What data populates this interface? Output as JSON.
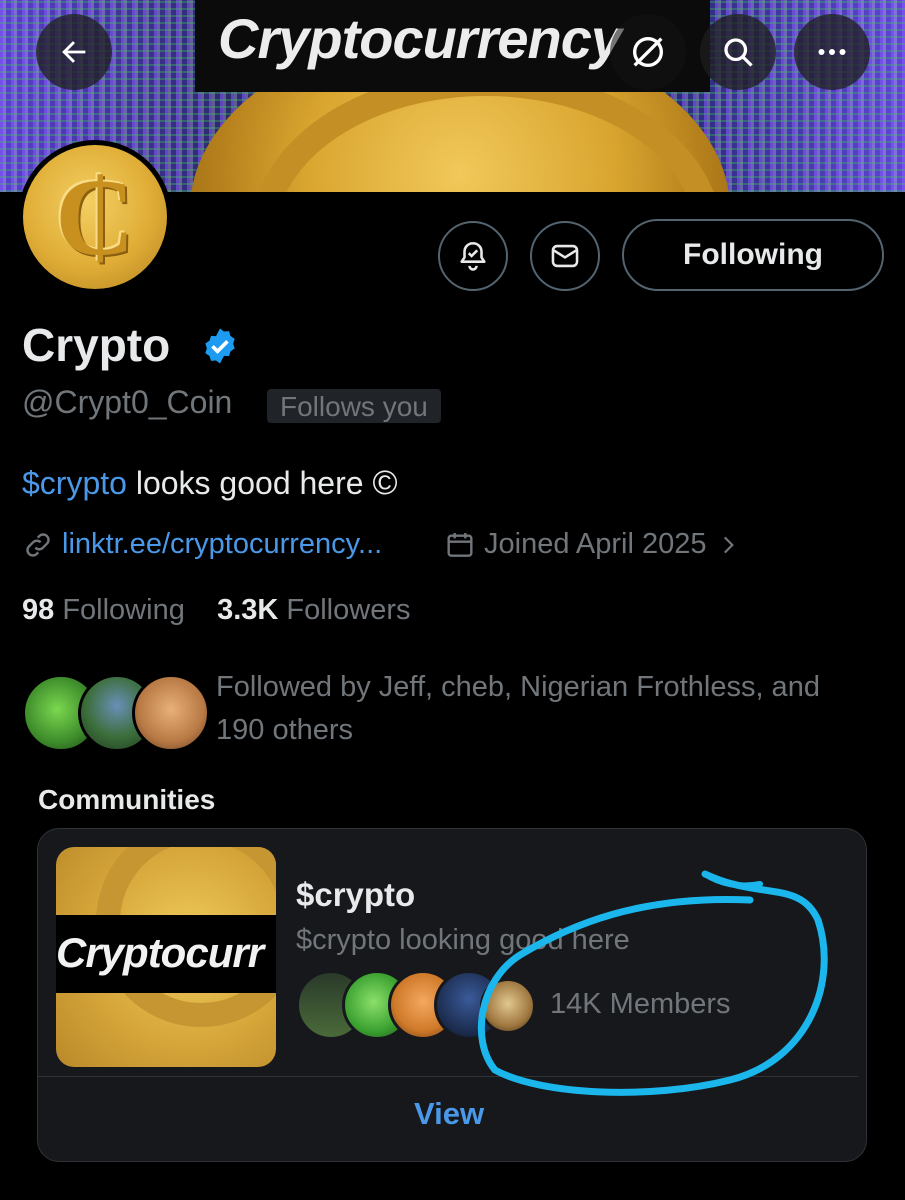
{
  "header": {
    "banner_title": "Cryptocurrency",
    "back_icon": "arrow-left-icon",
    "grok_icon": "slash-circle-icon",
    "search_icon": "search-icon",
    "more_icon": "more-horizontal-icon"
  },
  "profile": {
    "avatar_glyph": "₵",
    "name": "Crypto",
    "verified_icon": "verified-badge-icon",
    "handle": "@Crypt0_Coin",
    "follows_you": "Follows you",
    "bio_tag": "$crypto",
    "bio_text": " looks good here ",
    "bio_symbol": "©",
    "link": "linktr.ee/cryptocurrency...",
    "joined": "Joined April 2025",
    "following_count": "98",
    "following_label": "Following",
    "followers_count": "3.3K",
    "followers_label": "Followers",
    "followed_by": "Followed by Jeff, cheb, Nigerian Frothless, and 190 others"
  },
  "actions": {
    "notify_icon": "bell-check-icon",
    "message_icon": "envelope-icon",
    "following_button": "Following"
  },
  "communities": {
    "label": "Communities",
    "card": {
      "image_text": "Cryptocurr",
      "name": "$crypto",
      "description": "$crypto looking good here",
      "members": "14K Members",
      "view_button": "View"
    }
  },
  "colors": {
    "accent": "#4a99e9",
    "annotation": "#1ab6ec",
    "verified": "#1d9bf0"
  }
}
